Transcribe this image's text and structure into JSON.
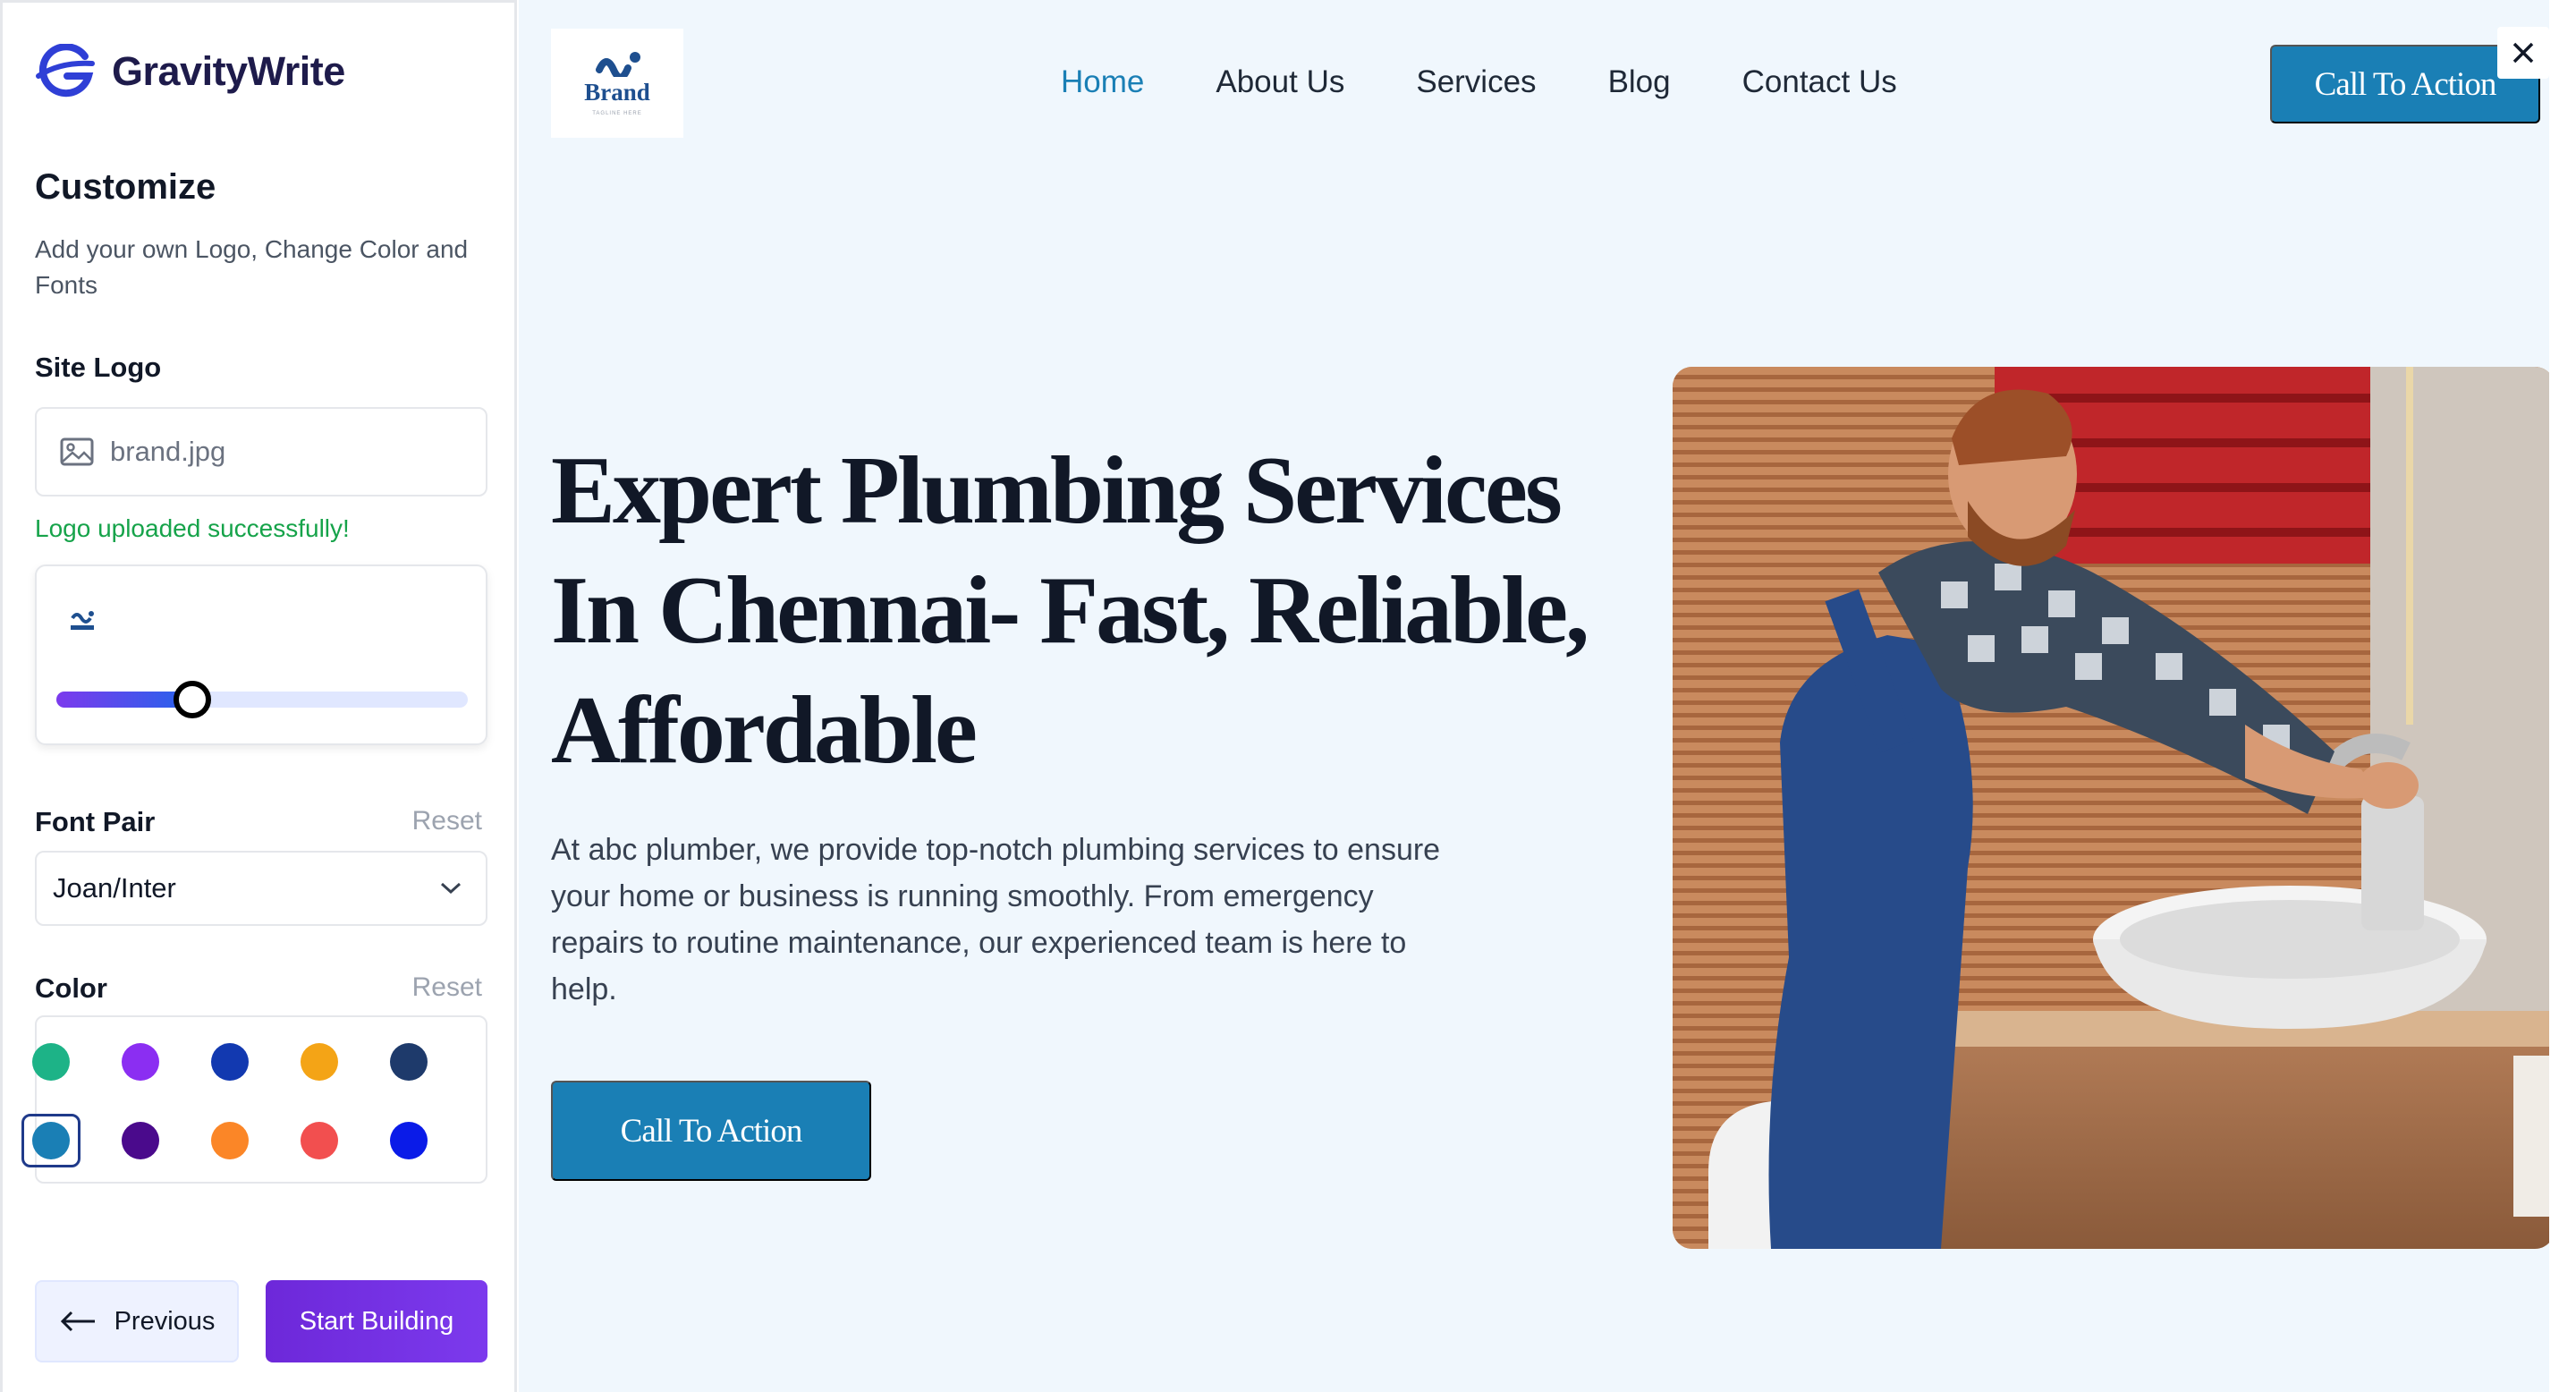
{
  "app": {
    "name": "GravityWrite"
  },
  "sidebar": {
    "title": "Customize",
    "subtitle": "Add your own Logo, Change Color and Fonts",
    "site_logo": {
      "label": "Site Logo",
      "file_name": "brand.jpg",
      "status": "Logo uploaded successfully!",
      "size_level_percent": 33
    },
    "font_pair": {
      "label": "Font Pair",
      "reset": "Reset",
      "value": "Joan/Inter"
    },
    "color": {
      "label": "Color",
      "reset": "Reset",
      "swatches": [
        "#1db387",
        "#8b2ef2",
        "#1239b0",
        "#f4a416",
        "#1e3a6b",
        "#1a7fb5",
        "#4a0a8c",
        "#fb8627",
        "#f24f4f",
        "#0a1be8"
      ],
      "selected": "#1a7fb5"
    },
    "previous_label": "Previous",
    "start_label": "Start Building"
  },
  "preview": {
    "logo_text": "Brand",
    "logo_tagline": "TAGLINE HERE",
    "nav": [
      "Home",
      "About Us",
      "Services",
      "Blog",
      "Contact Us"
    ],
    "nav_active": "Home",
    "cta_top": "Call To Action",
    "hero_title": "Expert Plumbing Services In Chennai- Fast, Reliable, Affordable",
    "hero_text": "At abc plumber, we provide top-notch plumbing services to ensure your home or business is running smoothly. From emergency repairs to routine maintenance, our experienced team is here to help.",
    "cta_hero": "Call To Action",
    "accent": "#1a7fb5",
    "background": "#f0f7fd"
  }
}
